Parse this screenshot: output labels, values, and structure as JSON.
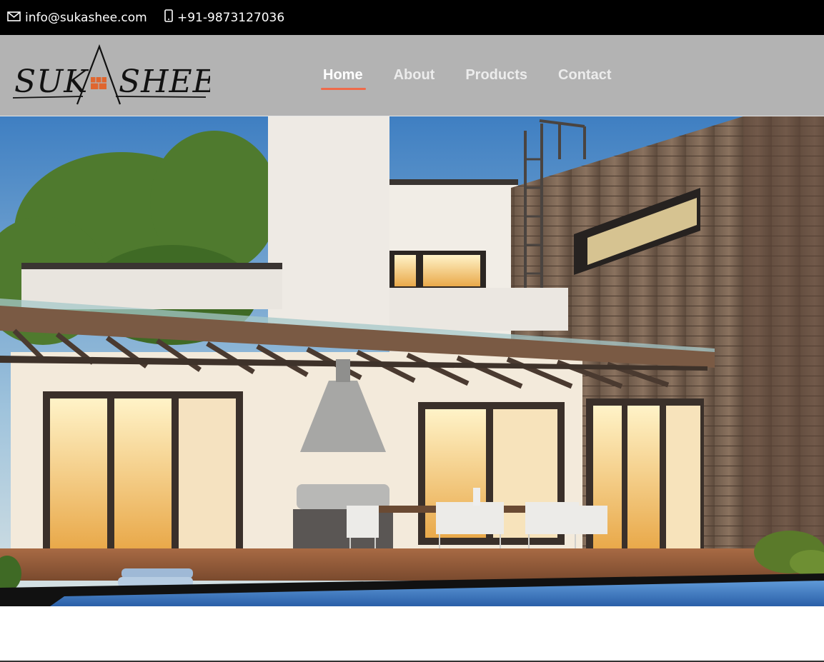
{
  "topbar": {
    "email": "info@sukashee.com",
    "phone": "+91-9873127036",
    "email_icon": "envelope-icon",
    "phone_icon": "mobile-phone-icon"
  },
  "header": {
    "logo_text": "SUKASHEE",
    "nav": [
      {
        "label": "Home",
        "active": true
      },
      {
        "label": "About",
        "active": false
      },
      {
        "label": "Products",
        "active": false
      },
      {
        "label": "Contact",
        "active": false
      }
    ]
  },
  "colors": {
    "topbar_bg": "#000000",
    "header_bg": "#b3b3b3",
    "nav_active_underline": "#ef6a4a"
  }
}
